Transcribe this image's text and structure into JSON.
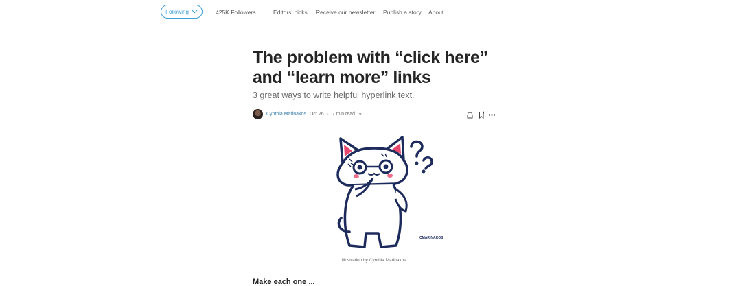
{
  "topbar": {
    "follow_label": "Following",
    "followers": "425K Followers",
    "separator": "·",
    "links": [
      "Editors' picks",
      "Receive our newsletter",
      "Publish a story",
      "About"
    ]
  },
  "article": {
    "title": "The problem with “click here” and “learn more” links",
    "subtitle": "3 great ways to write helpful hyperlink text.",
    "author": "Cynthia Marinakos",
    "date": "Oct 26",
    "dot": "·",
    "read_time": "7 min read",
    "member_star": "★",
    "image_signature": "CMARINAKOS",
    "caption": "Illustration by Cynthia Marinakos.",
    "next_heading": "Make each one ..."
  },
  "icons": {
    "follow_chevron": "chevron-down-icon",
    "share": "share-icon",
    "bookmark": "bookmark-icon",
    "more": "more-icon"
  },
  "colors": {
    "accent": "#3d9fd6",
    "text": "#242424",
    "muted": "#6b6b6b"
  }
}
